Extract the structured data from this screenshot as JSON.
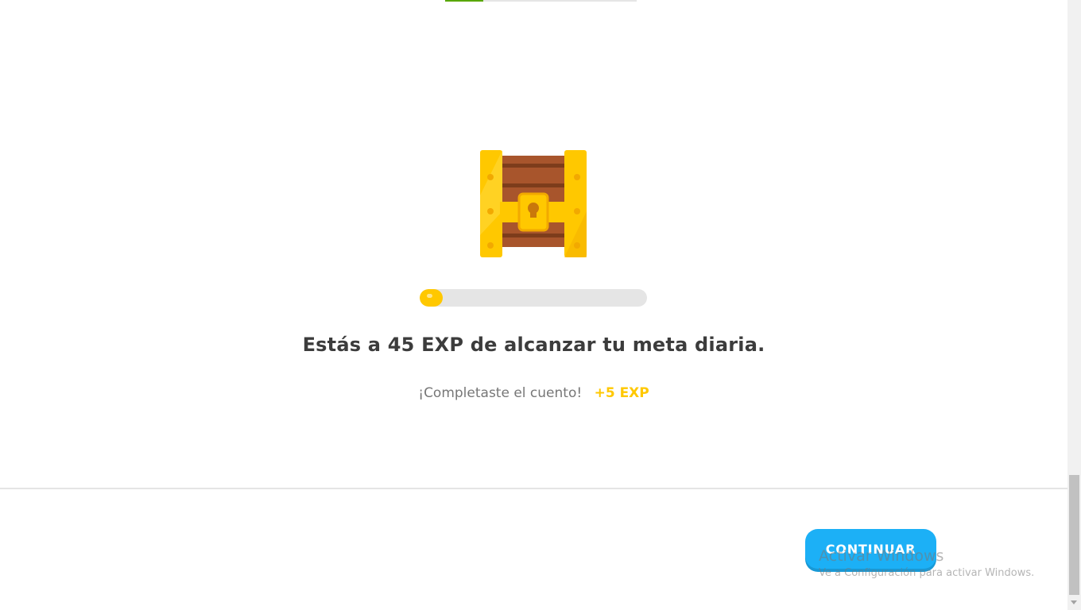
{
  "lesson_progress": {
    "fraction": 0.2
  },
  "reward": {
    "icon": "treasure-chest-icon",
    "goal_fraction": 0.1,
    "headline": "Estás a 45 EXP de alcanzar tu meta diaria.",
    "completed_text": "¡Completaste el cuento!",
    "xp_text": "+5 EXP"
  },
  "footer": {
    "continue_label": "CONTINUAR"
  },
  "watermark": {
    "title": "Activar Windows",
    "subtitle": "Ve a Configuración para activar Windows."
  },
  "scrollbar": {
    "arrow_icon": "arrow-down-icon"
  },
  "colors": {
    "accent": "#1cb0f6",
    "gold": "#ffc800",
    "text": "#3c3c3c",
    "muted": "#777777"
  }
}
